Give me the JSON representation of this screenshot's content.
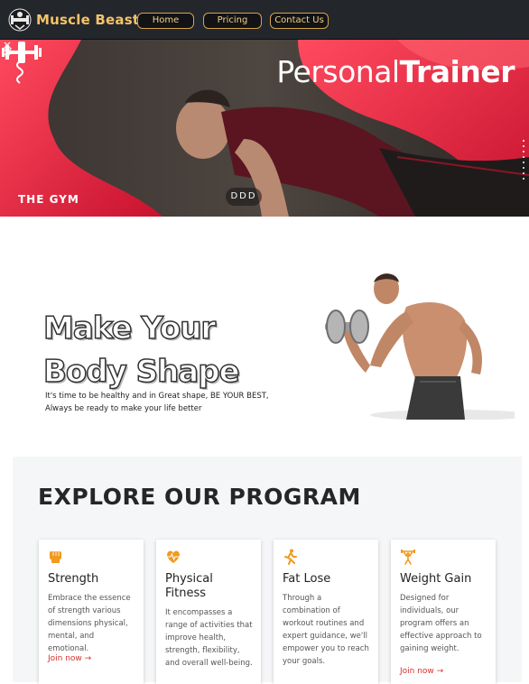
{
  "nav": {
    "brand": "Muscle Beast",
    "links": [
      "Home",
      "Pricing",
      "Contact Us"
    ]
  },
  "hero": {
    "title_light": "Personal",
    "title_bold": "Trainer",
    "logo_text": "THE GYM",
    "indicator": "DDD",
    "icons": [
      "chevron-left-icon",
      "chevron-right-icon",
      "dumbbell-icon"
    ],
    "colors": {
      "accent": "#e8344c"
    }
  },
  "shape": {
    "title_line1": "Make Your",
    "title_line2": "Body Shape",
    "desc_line1": "It's time to be healthy and in Great shape, BE YOUR BEST,",
    "desc_line2": "Always be ready to make your life better"
  },
  "program": {
    "title": "EXPLORE OUR PROGRAM",
    "cards": [
      {
        "title": "Strength",
        "desc": [
          "Embrace the essence",
          "of strength various",
          "dimensions physical,",
          "mental, and emotional."
        ],
        "link": "Join now →",
        "icon": "fist-icon"
      },
      {
        "title": "Physical Fitness",
        "title_line1": "Physical",
        "title_line2": "Fitness",
        "desc": [
          "It encompasses a",
          "range of activities that",
          "improve health,",
          "strength, flexibility,",
          "and overall well-being."
        ],
        "link": "",
        "icon": "heartbeat-icon"
      },
      {
        "title": "Fat Lose",
        "desc": [
          "Through a",
          "combination of",
          "workout routines and",
          "expert guidance, we'll",
          "empower you to reach",
          "your goals."
        ],
        "link": "",
        "icon": "running-icon"
      },
      {
        "title": "Weight Gain",
        "desc": [
          "Designed for",
          "individuals, our",
          "program offers an",
          "effective approach to",
          "gaining weight."
        ],
        "link": "Join now →",
        "icon": "weightlifter-icon"
      }
    ],
    "colors": {
      "icon": "#f29a1f",
      "link": "#d8302e"
    }
  }
}
